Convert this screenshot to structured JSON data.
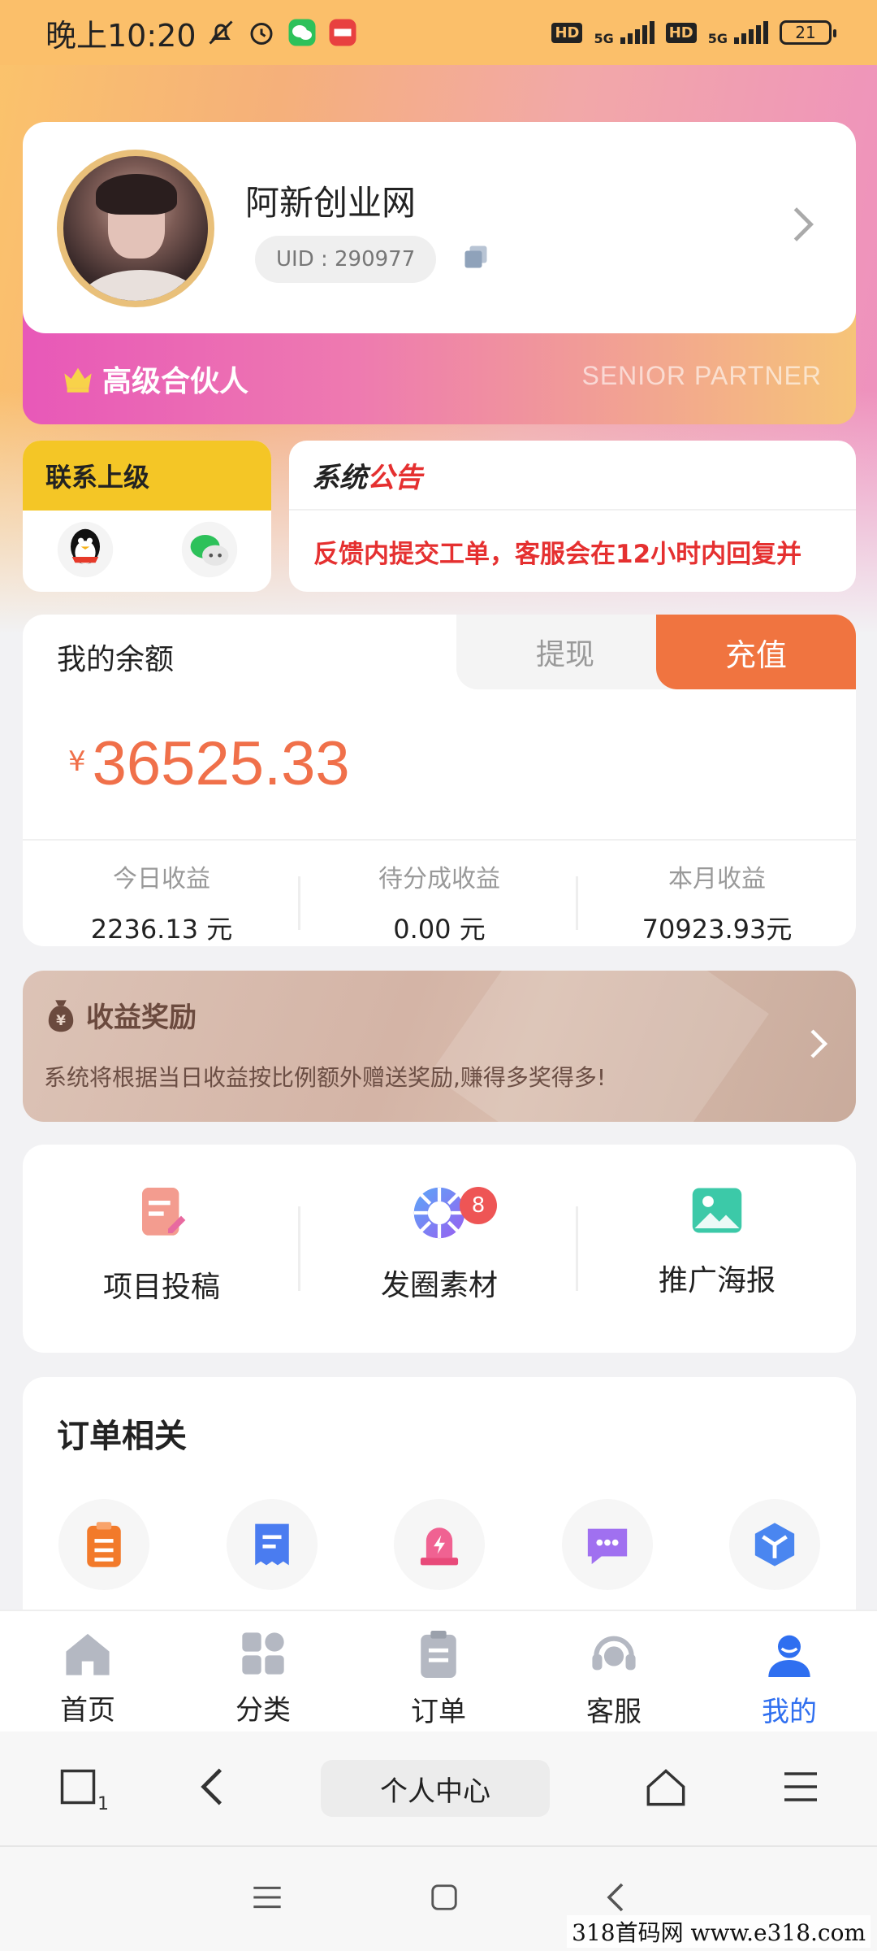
{
  "status_bar": {
    "time": "晚上10:20",
    "net1": "5G",
    "net2": "5G",
    "hd": "HD",
    "battery": "21"
  },
  "profile": {
    "name": "阿新创业网",
    "uid": "UID : 290977",
    "level": "高级合伙人",
    "level_en": "SENIOR PARTNER"
  },
  "contact": {
    "title": "联系上级"
  },
  "notice": {
    "title_part1": "系统",
    "title_part2": "公告",
    "text": "反馈内提交工单，客服会在12小时内回复并"
  },
  "balance": {
    "title": "我的余额",
    "withdraw_label": "提现",
    "recharge_label": "充值",
    "currency": "¥",
    "amount": "36525.33",
    "stats": [
      {
        "label": "今日收益",
        "value": "2236.13 元"
      },
      {
        "label": "待分成收益",
        "value": "0.00 元"
      },
      {
        "label": "本月收益",
        "value": "70923.93元"
      }
    ]
  },
  "reward": {
    "title": "收益奖励",
    "desc": "系统将根据当日收益按比例额外赠送奖励,赚得多奖得多!"
  },
  "tools": [
    {
      "label": "项目投稿",
      "icon": "edit-document-icon"
    },
    {
      "label": "发圈素材",
      "icon": "aperture-icon",
      "badge": "8"
    },
    {
      "label": "推广海报",
      "icon": "image-icon"
    }
  ],
  "orders": {
    "title": "订单相关",
    "icons": [
      "clipboard-icon",
      "receipt-icon",
      "alarm-icon",
      "message-icon",
      "box-icon"
    ]
  },
  "tabbar": [
    {
      "label": "首页",
      "icon": "home-icon"
    },
    {
      "label": "分类",
      "icon": "grid-icon"
    },
    {
      "label": "订单",
      "icon": "order-icon"
    },
    {
      "label": "客服",
      "icon": "headset-icon"
    },
    {
      "label": "我的",
      "icon": "user-icon",
      "active": true
    }
  ],
  "browser": {
    "tab_count": "1",
    "page_title": "个人中心"
  },
  "watermark": "318首码网 www.e318.com",
  "colors": {
    "accent": "#f07440",
    "amount": "#f0704a",
    "notice_red": "#e53030",
    "tab_active": "#2f6ff0",
    "contact_yellow": "#f4c626"
  }
}
